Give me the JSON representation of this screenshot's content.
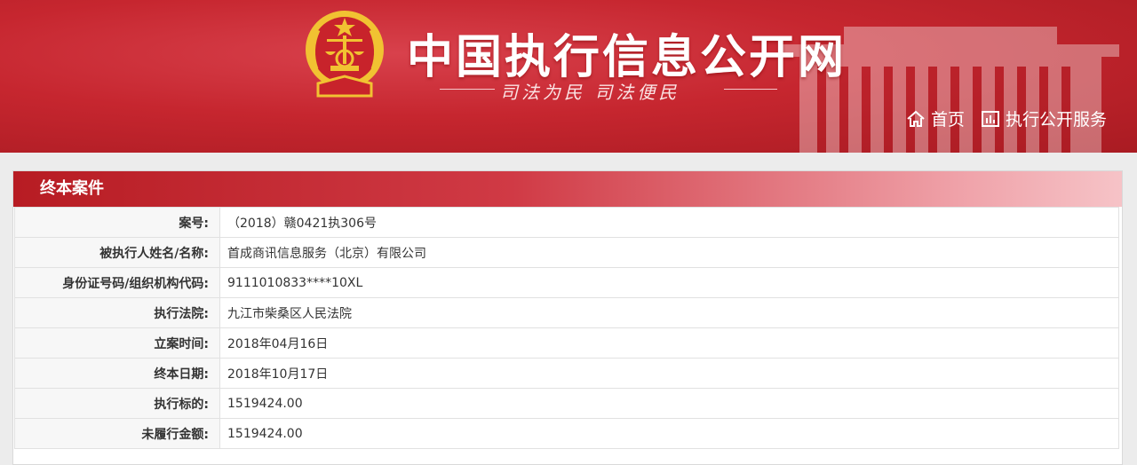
{
  "header": {
    "title": "中国执行信息公开网",
    "slogan": "司法为民  司法便民",
    "nav": [
      {
        "label": "首页",
        "icon": "home-icon"
      },
      {
        "label": "执行公开服务",
        "icon": "chart-icon"
      }
    ]
  },
  "panel": {
    "title": "终本案件",
    "rows": [
      {
        "label": "案号:",
        "value": "（2018）赣0421执306号"
      },
      {
        "label": "被执行人姓名/名称:",
        "value": "首成商讯信息服务（北京）有限公司"
      },
      {
        "label": "身份证号码/组织机构代码:",
        "value": "9111010833****10XL"
      },
      {
        "label": "执行法院:",
        "value": "九江市柴桑区人民法院"
      },
      {
        "label": "立案时间:",
        "value": "2018年04月16日"
      },
      {
        "label": "终本日期:",
        "value": "2018年10月17日"
      },
      {
        "label": "执行标的:",
        "value": "1519424.00"
      },
      {
        "label": "未履行金额:",
        "value": "1519424.00"
      }
    ]
  },
  "colors": {
    "header_red": "#c6262f",
    "emblem_gold": "#f1c232",
    "panel_head_start": "#b71c23",
    "panel_head_end": "#f6c3c7"
  }
}
